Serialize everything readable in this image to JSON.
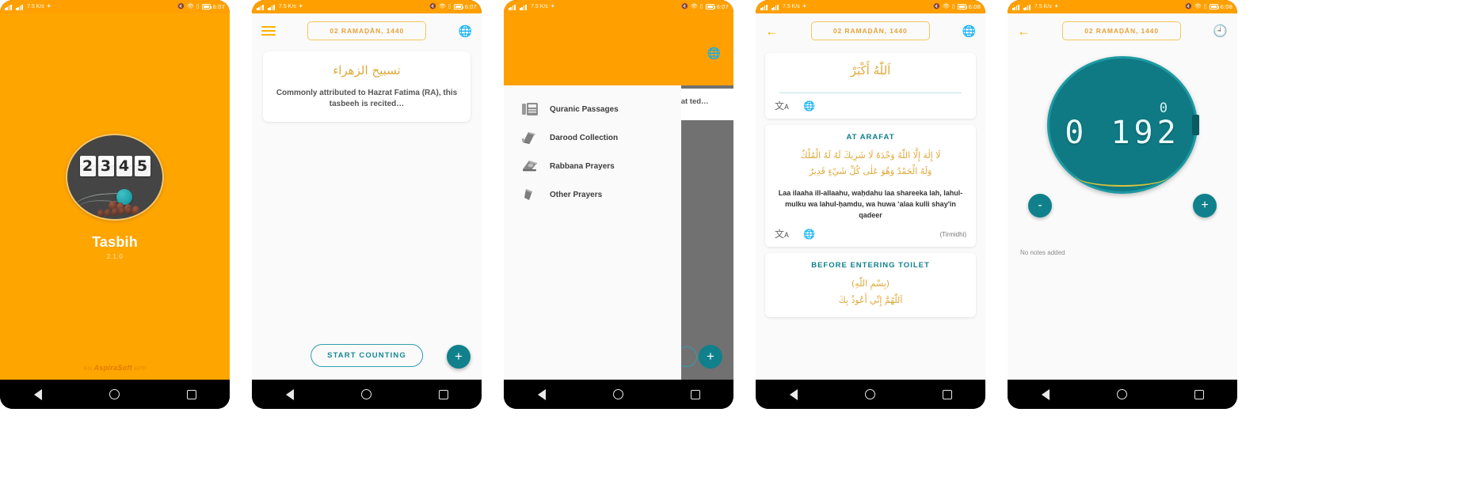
{
  "app": {
    "title": "Tasbih",
    "version": "2.1.0",
    "brand_prefix": "AN",
    "brand_name": "AspiraSoft",
    "brand_suffix": "APP",
    "splash_digits": [
      "2",
      "3",
      "4",
      "5"
    ],
    "accent_teal": "#10808c",
    "accent_orange": "#ffa000",
    "accent_gold": "#e0a93a"
  },
  "status_bar": {
    "screens": [
      {
        "time": "6:07"
      },
      {
        "time": "6:07"
      },
      {
        "time": "6:07"
      },
      {
        "time": "6:08"
      },
      {
        "time": "6:08"
      }
    ],
    "data_rate": "7.5 K/s",
    "icons": [
      "signal-icon",
      "signal-icon",
      "data-rate-icon",
      "location-icon",
      "mute-icon",
      "eye-icon",
      "vibrate-icon",
      "battery-icon"
    ]
  },
  "screen2": {
    "date_chip": "02 RAMAḌĀN, 1440",
    "menu_icon": "hamburger-icon",
    "globe_icon": "globe-icon",
    "card": {
      "arabic": "تسبيح الزهراء",
      "description": "Commonly attributed to Hazrat Fatima (RA), this tasbeeh is recited…"
    },
    "start_button": "START COUNTING",
    "fab_label": "+"
  },
  "screen3": {
    "drawer_items": [
      {
        "label": "Quranic Passages",
        "icon": "book-open-icon"
      },
      {
        "label": "Darood Collection",
        "icon": "books-stack-icon"
      },
      {
        "label": "Rabbana Prayers",
        "icon": "book-closed-icon"
      },
      {
        "label": "Other Prayers",
        "icon": "bookmark-icon"
      }
    ],
    "ghost_text": "rat ted…",
    "fab_label": "+"
  },
  "screen4": {
    "date_chip": "02 RAMAḌĀN, 1440",
    "back_icon": "back-arrow-icon",
    "globe_icon": "globe-icon",
    "cards": [
      {
        "title": "",
        "arabic": "اَللّٰهُ أَكْبَرْ",
        "translit": "",
        "source": "",
        "icons": [
          "translate-icon",
          "globe-icon"
        ]
      },
      {
        "title": "AT ARAFAT",
        "arabic_line1": "لَا إِلٰهَ إِلَّا اللّٰهُ وَحْدَهُ لَا شَرِيكَ لَهُ لَهُ الْمُلْكُ",
        "arabic_line2": "وَلَهُ الْحَمْدُ وَهُوَ عَلٰى كُلِّ شَيْءٍ قَدِيرٌ",
        "translit": "Laa ilaaha ill-allaahu, waḥdahu laa shareeka lah, lahul-mulku wa lahul-ḥamdu, wa huwa ʻalaa kulli shay'in qadeer",
        "source": "(Tirmidhi)",
        "icons": [
          "translate-icon",
          "globe-icon"
        ]
      },
      {
        "title": "BEFORE ENTERING TOILET",
        "arabic_line1": "(بِسْمِ اللّٰهِ)",
        "arabic_line2": "اَللّٰهُمَّ إِنِّي أَعُوذُ بِكَ",
        "translit": "",
        "source": ""
      }
    ]
  },
  "screen5": {
    "date_chip": "02 RAMAḌĀN, 1440",
    "back_icon": "back-arrow-icon",
    "history_icon": "history-icon",
    "counter_target": "0",
    "counter_value": "0 192",
    "decrement_label": "-",
    "increment_label": "+",
    "notes_text": "No notes added"
  },
  "nav_bar": {
    "back": "nav-back-icon",
    "home": "nav-home-icon",
    "recents": "nav-recents-icon"
  }
}
